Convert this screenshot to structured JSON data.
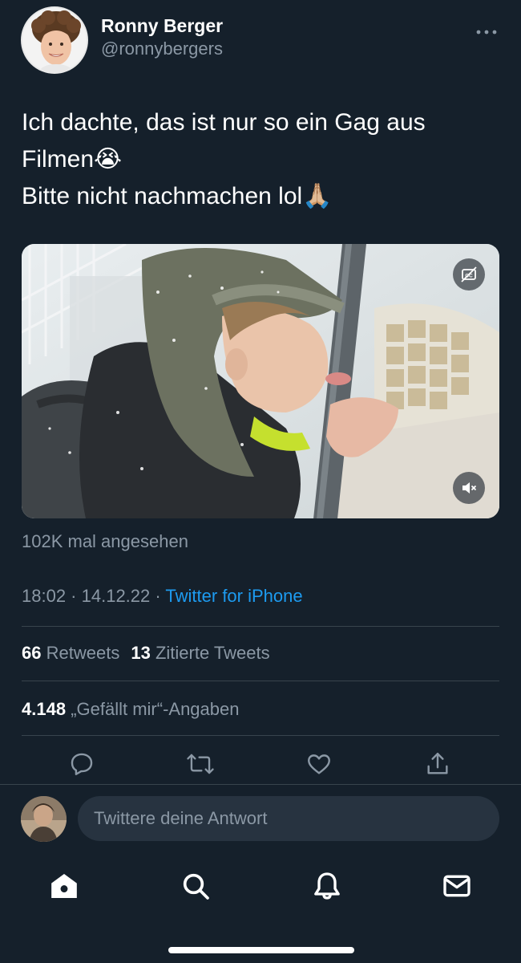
{
  "author": {
    "display_name": "Ronny Berger",
    "handle": "@ronnybergers",
    "more_icon": "more-horizontal-icon"
  },
  "tweet": {
    "lines": [
      "Ich dachte, das ist nur so ein Gag aus",
      "Filmen😭",
      "Bitte nicht nachmachen lol🙏🏼"
    ]
  },
  "media": {
    "captions_icon": "captions-off-icon",
    "mute_icon": "muted-speaker-icon"
  },
  "views": "102K mal angesehen",
  "meta": {
    "time": "18:02",
    "date": "14.12.22",
    "separator": " · ",
    "source": "Twitter for iPhone"
  },
  "stats": {
    "retweets_count": "66",
    "retweets_label": "Retweets",
    "quotes_count": "13",
    "quotes_label": "Zitierte Tweets",
    "likes_count": "4.148",
    "likes_label": "„Gefällt mir“-Angaben"
  },
  "actions": [
    "reply-icon",
    "retweet-icon",
    "like-icon",
    "share-icon"
  ],
  "reply": {
    "placeholder": "Twittere deine Antwort"
  },
  "tabbar": [
    "home-icon",
    "search-icon",
    "notifications-icon",
    "messages-icon"
  ],
  "colors": {
    "background": "#15202b",
    "accent": "#1d9bf0",
    "secondary_text": "#8b98a5",
    "divider": "#38444d"
  }
}
